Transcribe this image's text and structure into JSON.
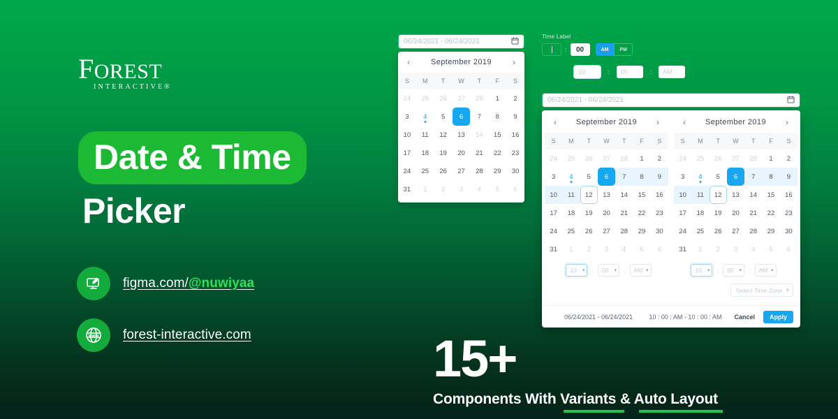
{
  "brand": {
    "logo_main": "OREST",
    "logo_initial": "F",
    "logo_sub": "INTERACTIVE®"
  },
  "hero": {
    "title_line1": "Date & Time",
    "title_line2": "Picker",
    "highlight_color": "#1bb934"
  },
  "links": [
    {
      "icon": "figma-design-icon",
      "text_plain": "figma.com/",
      "text_accent": "@nuwiyaa"
    },
    {
      "icon": "globe-www-icon",
      "text_plain": "forest-interactive.com",
      "text_accent": ""
    }
  ],
  "count": {
    "number": "15+",
    "caption": "Components With Variants & Auto Layout"
  },
  "small_picker": {
    "input_placeholder": "06/24/2021 - 06/24/2021",
    "calendar_icon": "calendar-icon",
    "prev_label": "‹",
    "next_label": "›",
    "month": "September 2019",
    "dow": [
      "S",
      "M",
      "T",
      "W",
      "T",
      "F",
      "S"
    ],
    "weeks": [
      [
        {
          "d": "24",
          "s": "mut"
        },
        {
          "d": "25",
          "s": "mut"
        },
        {
          "d": "26",
          "s": "mut"
        },
        {
          "d": "27",
          "s": "mut"
        },
        {
          "d": "28",
          "s": "mut"
        },
        {
          "d": "1",
          "s": ""
        },
        {
          "d": "2",
          "s": ""
        }
      ],
      [
        {
          "d": "3",
          "s": ""
        },
        {
          "d": "4",
          "s": "today"
        },
        {
          "d": "5",
          "s": ""
        },
        {
          "d": "6",
          "s": "sel"
        },
        {
          "d": "7",
          "s": ""
        },
        {
          "d": "8",
          "s": ""
        },
        {
          "d": "9",
          "s": ""
        }
      ],
      [
        {
          "d": "10",
          "s": ""
        },
        {
          "d": "11",
          "s": ""
        },
        {
          "d": "12",
          "s": ""
        },
        {
          "d": "13",
          "s": ""
        },
        {
          "d": "14",
          "s": "mut"
        },
        {
          "d": "15",
          "s": ""
        },
        {
          "d": "16",
          "s": ""
        }
      ],
      [
        {
          "d": "17",
          "s": ""
        },
        {
          "d": "18",
          "s": ""
        },
        {
          "d": "19",
          "s": ""
        },
        {
          "d": "20",
          "s": ""
        },
        {
          "d": "21",
          "s": ""
        },
        {
          "d": "22",
          "s": ""
        },
        {
          "d": "23",
          "s": ""
        }
      ],
      [
        {
          "d": "24",
          "s": ""
        },
        {
          "d": "25",
          "s": ""
        },
        {
          "d": "26",
          "s": ""
        },
        {
          "d": "27",
          "s": ""
        },
        {
          "d": "28",
          "s": ""
        },
        {
          "d": "29",
          "s": ""
        },
        {
          "d": "30",
          "s": ""
        }
      ],
      [
        {
          "d": "31",
          "s": ""
        },
        {
          "d": "1",
          "s": "mut"
        },
        {
          "d": "2",
          "s": "mut"
        },
        {
          "d": "3",
          "s": "mut"
        },
        {
          "d": "4",
          "s": "mut"
        },
        {
          "d": "5",
          "s": "mut"
        },
        {
          "d": "6",
          "s": "mut"
        }
      ]
    ]
  },
  "time_widgets": {
    "label": "Time Label",
    "hour_value": "",
    "minute_value": "00",
    "separator": ":",
    "am_label": "AM",
    "pm_label": "PM",
    "am_active": true,
    "row2": {
      "hour": "10",
      "minute": "00",
      "meridiem": "AM",
      "sep1": ":",
      "sep2": ":"
    }
  },
  "big_picker": {
    "input_placeholder": "06/24/2021 - 06/24/2021",
    "calendar_icon": "calendar-icon",
    "calendars": [
      {
        "prev_label": "‹",
        "next_label": "›",
        "month": "September 2019",
        "dow": [
          "S",
          "M",
          "T",
          "W",
          "T",
          "F",
          "S"
        ],
        "weeks": [
          [
            {
              "d": "24",
              "s": "mut"
            },
            {
              "d": "25",
              "s": "mut"
            },
            {
              "d": "26",
              "s": "mut"
            },
            {
              "d": "27",
              "s": "mut"
            },
            {
              "d": "28",
              "s": "mut"
            },
            {
              "d": "1",
              "s": ""
            },
            {
              "d": "2",
              "s": ""
            }
          ],
          [
            {
              "d": "3",
              "s": ""
            },
            {
              "d": "4",
              "s": "today"
            },
            {
              "d": "5",
              "s": ""
            },
            {
              "d": "6",
              "s": "sel"
            },
            {
              "d": "7",
              "s": "inrange"
            },
            {
              "d": "8",
              "s": "inrange"
            },
            {
              "d": "9",
              "s": "inrange"
            }
          ],
          [
            {
              "d": "10",
              "s": "inrange"
            },
            {
              "d": "11",
              "s": "inrange"
            },
            {
              "d": "12",
              "s": "endbox"
            },
            {
              "d": "13",
              "s": ""
            },
            {
              "d": "14",
              "s": ""
            },
            {
              "d": "15",
              "s": ""
            },
            {
              "d": "16",
              "s": ""
            }
          ],
          [
            {
              "d": "17",
              "s": ""
            },
            {
              "d": "18",
              "s": ""
            },
            {
              "d": "19",
              "s": ""
            },
            {
              "d": "20",
              "s": ""
            },
            {
              "d": "21",
              "s": ""
            },
            {
              "d": "22",
              "s": ""
            },
            {
              "d": "23",
              "s": ""
            }
          ],
          [
            {
              "d": "24",
              "s": ""
            },
            {
              "d": "25",
              "s": ""
            },
            {
              "d": "26",
              "s": ""
            },
            {
              "d": "27",
              "s": ""
            },
            {
              "d": "28",
              "s": ""
            },
            {
              "d": "29",
              "s": ""
            },
            {
              "d": "30",
              "s": ""
            }
          ],
          [
            {
              "d": "31",
              "s": ""
            },
            {
              "d": "1",
              "s": "mut"
            },
            {
              "d": "2",
              "s": "mut"
            },
            {
              "d": "3",
              "s": "mut"
            },
            {
              "d": "4",
              "s": "mut"
            },
            {
              "d": "5",
              "s": "mut"
            },
            {
              "d": "6",
              "s": "mut"
            }
          ]
        ]
      },
      {
        "prev_label": "‹",
        "next_label": "›",
        "month": "September 2019",
        "dow": [
          "S",
          "M",
          "T",
          "W",
          "T",
          "F",
          "S"
        ],
        "weeks": [
          [
            {
              "d": "24",
              "s": "mut"
            },
            {
              "d": "25",
              "s": "mut"
            },
            {
              "d": "26",
              "s": "mut"
            },
            {
              "d": "27",
              "s": "mut"
            },
            {
              "d": "28",
              "s": "mut"
            },
            {
              "d": "1",
              "s": ""
            },
            {
              "d": "2",
              "s": ""
            }
          ],
          [
            {
              "d": "3",
              "s": ""
            },
            {
              "d": "4",
              "s": "today"
            },
            {
              "d": "5",
              "s": ""
            },
            {
              "d": "6",
              "s": "sel"
            },
            {
              "d": "7",
              "s": "inrange"
            },
            {
              "d": "8",
              "s": "inrange"
            },
            {
              "d": "9",
              "s": "inrange"
            }
          ],
          [
            {
              "d": "10",
              "s": "inrange"
            },
            {
              "d": "11",
              "s": "inrange"
            },
            {
              "d": "12",
              "s": "endbox"
            },
            {
              "d": "13",
              "s": ""
            },
            {
              "d": "14",
              "s": ""
            },
            {
              "d": "15",
              "s": ""
            },
            {
              "d": "16",
              "s": ""
            }
          ],
          [
            {
              "d": "17",
              "s": ""
            },
            {
              "d": "18",
              "s": ""
            },
            {
              "d": "19",
              "s": ""
            },
            {
              "d": "20",
              "s": ""
            },
            {
              "d": "21",
              "s": ""
            },
            {
              "d": "22",
              "s": ""
            },
            {
              "d": "23",
              "s": ""
            }
          ],
          [
            {
              "d": "24",
              "s": ""
            },
            {
              "d": "25",
              "s": ""
            },
            {
              "d": "26",
              "s": ""
            },
            {
              "d": "27",
              "s": ""
            },
            {
              "d": "28",
              "s": ""
            },
            {
              "d": "29",
              "s": ""
            },
            {
              "d": "30",
              "s": ""
            }
          ],
          [
            {
              "d": "31",
              "s": ""
            },
            {
              "d": "1",
              "s": "mut"
            },
            {
              "d": "2",
              "s": "mut"
            },
            {
              "d": "3",
              "s": "mut"
            },
            {
              "d": "4",
              "s": "mut"
            },
            {
              "d": "5",
              "s": "mut"
            },
            {
              "d": "6",
              "s": "mut"
            }
          ]
        ]
      }
    ],
    "time_selectors": [
      {
        "hour": "10",
        "minute": "00",
        "meridiem": "AM",
        "sep1": ":",
        "sep2": ":"
      },
      {
        "hour": "10",
        "minute": "00",
        "meridiem": "AM",
        "sep1": ":",
        "sep2": ":"
      }
    ],
    "timezone_placeholder": "Select Time Zone",
    "footer": {
      "date_range": "06/24/2021 - 06/24/2021",
      "time_range": "10 : 00 : AM - 10 : 00 : AM",
      "cancel_label": "Cancel",
      "apply_label": "Apply",
      "apply_color": "#16a7f0"
    }
  }
}
